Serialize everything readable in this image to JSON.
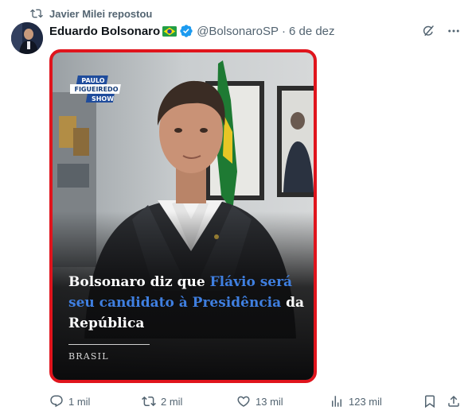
{
  "repost": {
    "text": "Javier Milei repostou"
  },
  "tweet": {
    "author_name": "Eduardo Bolsonaro",
    "handle": "@BolsonaroSP",
    "separator": "·",
    "time": "6 de dez"
  },
  "media": {
    "logo": {
      "line1": "PAULO",
      "line2": "FIGUEIREDO",
      "line3": "SHOW"
    },
    "headline": {
      "part1": "Bolsonaro diz que ",
      "highlight1": "Flávio será seu candidato à Presidência",
      "part2": " da República"
    },
    "category": "BRASIL",
    "border_color": "#e0141c",
    "highlight_color": "#3f7fe0"
  },
  "actions": {
    "replies": "1 mil",
    "reposts": "2 mil",
    "likes": "13 mil",
    "views": "123 mil"
  },
  "icons": {
    "repost": "repost-icon",
    "verified": "verified-badge-icon",
    "flag": "brazil-flag-icon",
    "grok": "grok-icon",
    "more": "more-icon",
    "reply": "reply-icon",
    "retweet": "retweet-icon",
    "like": "heart-icon",
    "views": "views-icon",
    "bookmark": "bookmark-icon",
    "share": "share-icon"
  },
  "colors": {
    "text_secondary": "#536471",
    "verified": "#1d9bf0"
  }
}
